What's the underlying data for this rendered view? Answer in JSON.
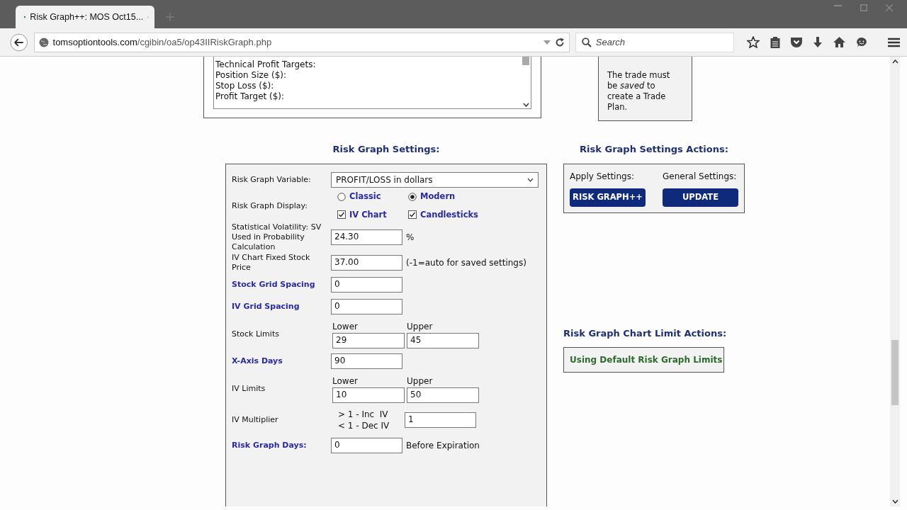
{
  "browser": {
    "tab_title": "Risk Graph++: MOS Oct15...",
    "url_host": "tomsoptiontools.com",
    "url_path": "/cgibin/oa5/op43IIRiskGraph.php",
    "search_placeholder": "Search"
  },
  "trade_plan": {
    "lines": [
      "Technical Profit Targets:",
      "Position Size ($):",
      "Stop Loss ($):",
      "Profit Target ($):"
    ]
  },
  "note": {
    "text": "The trade must be *saved* to create a Trade Plan."
  },
  "settings": {
    "title": "Risk Graph Settings:",
    "rows": [
      {
        "kind": "select",
        "label": "Risk Graph Variable:",
        "link": false,
        "value": "PROFIT/LOSS in dollars"
      },
      {
        "kind": "display",
        "label": "Risk Graph Display:",
        "link": false,
        "options": [
          {
            "label": "Classic",
            "selected": false
          },
          {
            "label": "Modern",
            "selected": true
          }
        ],
        "checks": [
          {
            "label": "IV Chart",
            "checked": true
          },
          {
            "label": "Candlesticks",
            "checked": true
          }
        ]
      },
      {
        "kind": "input",
        "label": "Statistical Volatility: SV Used in Probability Calculation",
        "link": false,
        "value": "24.30",
        "suffix": "%"
      },
      {
        "kind": "input",
        "label": "IV Chart Fixed Stock Price",
        "link": false,
        "value": "37.00",
        "suffix": "(-1=auto for saved settings)"
      },
      {
        "kind": "input",
        "label": "Stock Grid Spacing",
        "link": true,
        "value": "0"
      },
      {
        "kind": "input",
        "label": "IV Grid Spacing",
        "link": true,
        "value": "0"
      },
      {
        "kind": "range",
        "label": "Stock Limits",
        "link": false,
        "lower_label": "Lower",
        "upper_label": "Upper",
        "lower": "29",
        "upper": "45"
      },
      {
        "kind": "input",
        "label": "X-Axis Days",
        "link": true,
        "value": "90"
      },
      {
        "kind": "range",
        "label": "IV Limits",
        "link": false,
        "lower_label": "Lower",
        "upper_label": "Upper",
        "lower": "10",
        "upper": "50"
      },
      {
        "kind": "multiplier",
        "label": "IV Multiplier",
        "link": false,
        "hints": [
          "> 1 - Inc  IV",
          "< 1 - Dec IV"
        ],
        "value": "1"
      },
      {
        "kind": "input",
        "label": "Risk Graph Days:",
        "link": true,
        "value": "0",
        "suffix": "Before Expiration"
      }
    ]
  },
  "actions": {
    "title": "Risk Graph Settings Actions:",
    "groups": [
      {
        "label": "Apply Settings:",
        "button": "RISK GRAPH++"
      },
      {
        "label": "General Settings:",
        "button": "UPDATE"
      }
    ]
  },
  "chart_limits": {
    "title": "Risk Graph Chart Limit Actions:",
    "status": "Using Default Risk Graph Limits"
  }
}
